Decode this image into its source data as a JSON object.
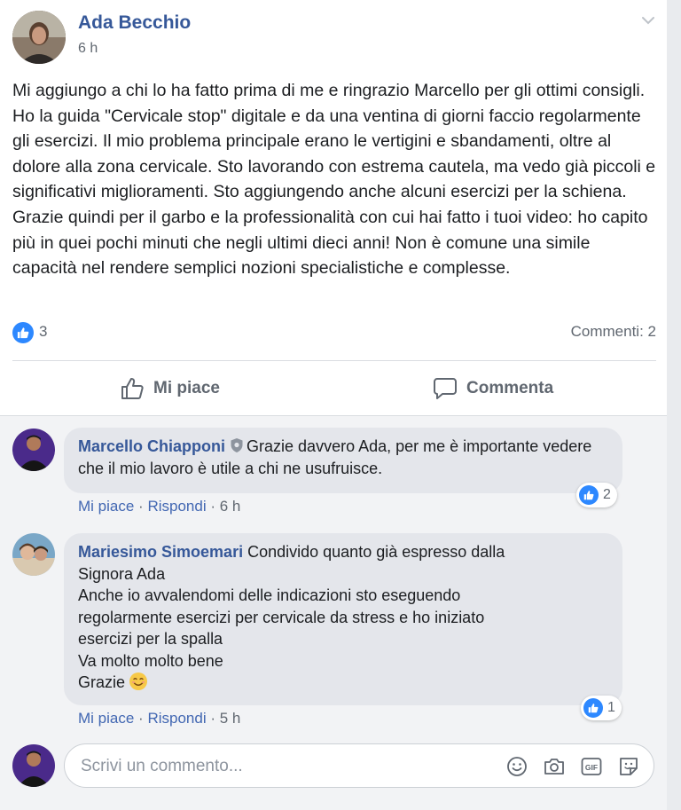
{
  "post": {
    "author": "Ada Becchio",
    "time": "6 h",
    "text": "Mi aggiungo a chi lo ha fatto prima di me e ringrazio Marcello per gli ottimi consigli. Ho la guida \"Cervicale stop\" digitale e da una ventina di giorni faccio regolarmente gli esercizi. Il mio problema principale erano le vertigini e sbandamenti, oltre al dolore alla zona cervicale. Sto lavorando con estrema cautela, ma vedo già piccoli e significativi miglioramenti. Sto aggiungendo anche alcuni esercizi per la schiena. Grazie quindi per il garbo e la professionalità con cui hai fatto i tuoi video: ho capito più in quei pochi minuti che negli ultimi dieci anni! Non è comune una simile capacità nel rendere semplici nozioni specialistiche e complesse.",
    "likes_count": "3",
    "comments_count": "Commenti: 2"
  },
  "actions": {
    "like_label": "Mi piace",
    "comment_label": "Commenta"
  },
  "comments": [
    {
      "name": "Marcello Chiapponi",
      "text": "Grazie davvero Ada, per me è importante vedere che il mio lavoro è utile a chi ne usufruisce.",
      "like_link": "Mi piace",
      "reply_link": "Rispondi",
      "separator": "·",
      "time": "6 h",
      "reactions": "2"
    },
    {
      "name": "Mariesimo Simoemari",
      "text_lines": [
        "Condivido quanto già espresso dalla",
        "Signora Ada",
        "Anche io avvalendomi delle indicazioni sto eseguendo",
        "regolarmente esercizi per cervicale da stress e ho iniziato",
        "esercizi per la spalla",
        "Va molto molto bene",
        "Grazie"
      ],
      "like_link": "Mi piace",
      "reply_link": "Rispondi",
      "separator": "·",
      "time": "5 h",
      "reactions": "1"
    }
  ],
  "composer": {
    "placeholder": "Scrivi un commento..."
  },
  "icons": {
    "menu": "chevron-down-icon",
    "like": "thumbs-up-icon",
    "comment": "speech-bubble-icon",
    "verified": "shield-badge-icon",
    "emoji": "smiley-icon",
    "photo": "camera-icon",
    "gif": "gif-icon",
    "sticker": "sticker-icon"
  },
  "colors": {
    "link_blue": "#365899",
    "reaction_blue": "#2d88ff",
    "muted_text": "#606770",
    "comment_bg": "#e4e6eb"
  }
}
